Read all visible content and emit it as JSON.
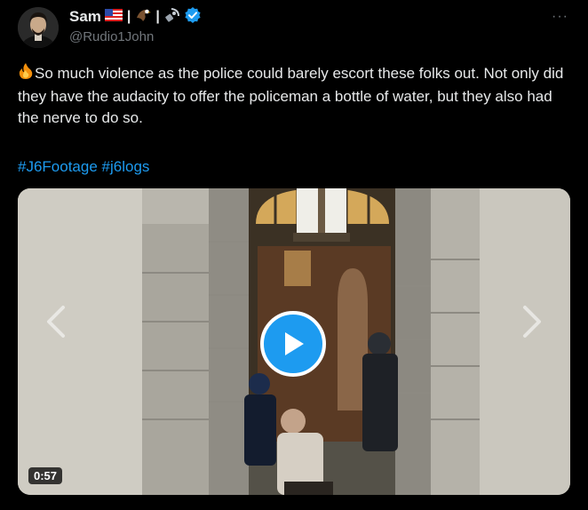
{
  "author": {
    "name": "Sam",
    "handle": "@Rudio1John",
    "verified_color": "#1d9bf0"
  },
  "tweet": {
    "text": "So much violence as the police could barely escort these folks out. Not only did they have the audacity to offer the policeman a bottle of water, but they also had the nerve to do so.",
    "hashtags": [
      "#J6Footage",
      "#j6logs"
    ]
  },
  "media": {
    "duration": "0:57"
  },
  "icons": {
    "more": "more-options-icon",
    "play": "play-icon",
    "prev": "chevron-left-icon",
    "next": "chevron-right-icon"
  },
  "colors": {
    "accent": "#1d9bf0",
    "text": "#e7e9ea",
    "secondary": "#71767b",
    "background": "#000000"
  }
}
